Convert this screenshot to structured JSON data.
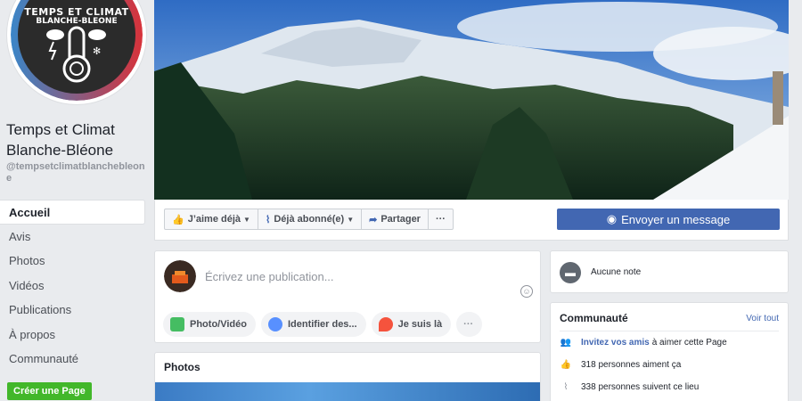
{
  "page": {
    "name": "Temps et Climat Blanche-Bléone",
    "handle": "@tempsetclimatblanchebleone",
    "logo_line1": "TEMPS ET CLIMAT",
    "logo_line2": "BLANCHE-BLEONE"
  },
  "nav": {
    "items": [
      "Accueil",
      "Avis",
      "Photos",
      "Vidéos",
      "Publications",
      "À propos",
      "Communauté"
    ],
    "active": "Accueil",
    "create_page": "Créer une Page"
  },
  "actions": {
    "like": "J’aime déjà",
    "follow": "Déjà abonné(e)",
    "share": "Partager",
    "more": "···",
    "message": "Envoyer un message"
  },
  "composer": {
    "placeholder": "Écrivez une publication...",
    "photo_video": "Photo/Vidéo",
    "tag": "Identifier des...",
    "checkin": "Je suis là",
    "more": "···"
  },
  "photos": {
    "title": "Photos"
  },
  "notes": {
    "label": "Aucune note"
  },
  "community": {
    "title": "Communauté",
    "see_all": "Voir tout",
    "invite_link": "Invitez vos amis",
    "invite_rest": "à aimer cette Page",
    "likes": "318 personnes aiment ça",
    "follows": "338 personnes suivent ce lieu"
  },
  "colors": {
    "brand": "#4267b2",
    "create_page": "#42b72a",
    "background": "#e9ebee"
  }
}
